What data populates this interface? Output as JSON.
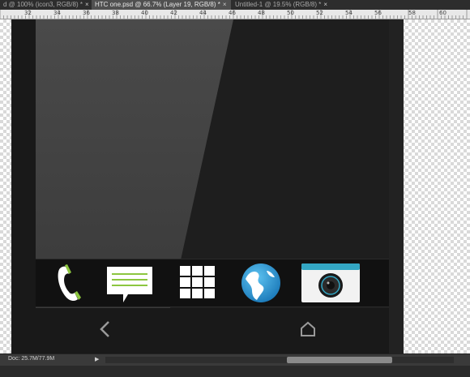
{
  "tabs": [
    {
      "label": "d @ 100% (icon3, RGB/8) *",
      "close": "×"
    },
    {
      "label": "HTC one.psd @ 66.7% (Layer 19, RGB/8) *",
      "close": "×"
    },
    {
      "label": "Untitled-1 @ 19.5% (RGB/8) *",
      "close": "×"
    }
  ],
  "ruler": {
    "labels": [
      "32",
      "34",
      "36",
      "38",
      "40",
      "42",
      "44",
      "46",
      "48",
      "50",
      "52",
      "54",
      "56",
      "58",
      "60"
    ]
  },
  "dock": {
    "icons": [
      "phone-icon",
      "messages-icon",
      "apps-grid-icon",
      "globe-icon",
      "camera-icon"
    ]
  },
  "nav": {
    "back_icon": "chevron-left-icon",
    "home_icon": "home-icon"
  },
  "status": {
    "doc": "Doc: 25.7M/77.9M",
    "arrow": "▶"
  },
  "colors": {
    "accent_green": "#8cc63f",
    "globe_blue": "#2e9ad6",
    "camera_teal": "#33a6c4"
  }
}
